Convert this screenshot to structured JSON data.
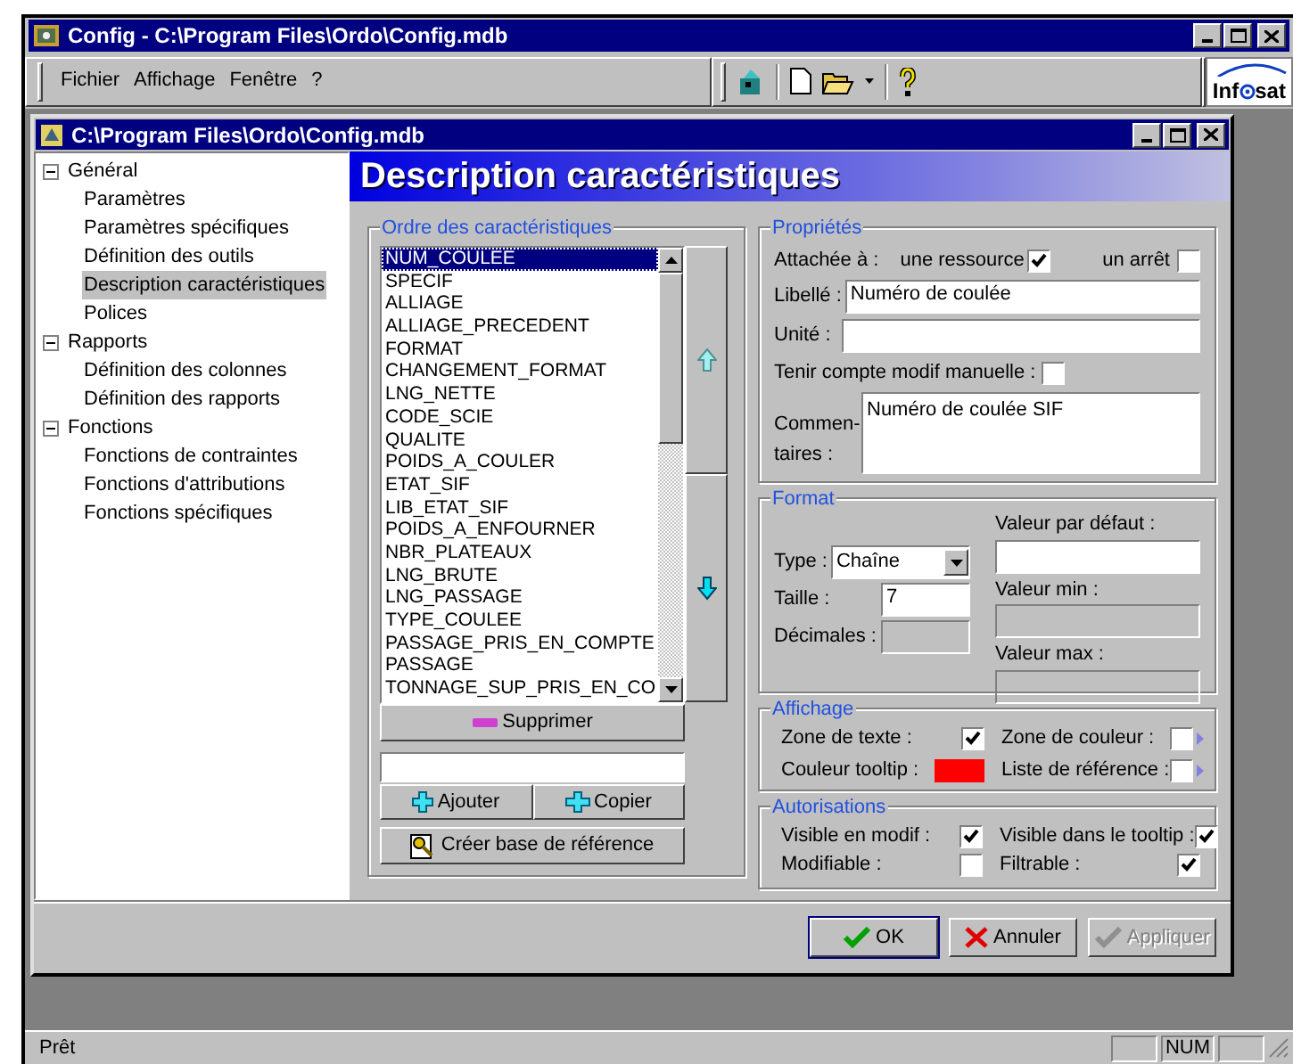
{
  "window": {
    "title": "Config - C:\\Program Files\\Ordo\\Config.mdb"
  },
  "menu": [
    "Fichier",
    "Affichage",
    "Fenêtre",
    "?"
  ],
  "logo": {
    "left": "Inf",
    "right": "sat"
  },
  "child_window": {
    "title": "C:\\Program Files\\Ordo\\Config.mdb"
  },
  "tree": [
    {
      "label": "Général",
      "expanded": true,
      "selected": false,
      "children": [
        {
          "label": "Paramètres",
          "selected": false
        },
        {
          "label": "Paramètres spécifiques",
          "selected": false
        },
        {
          "label": "Définition des outils",
          "selected": false
        },
        {
          "label": "Description caractéristiques",
          "selected": true
        },
        {
          "label": "Polices",
          "selected": false
        }
      ]
    },
    {
      "label": "Rapports",
      "expanded": true,
      "selected": false,
      "children": [
        {
          "label": "Définition des colonnes",
          "selected": false
        },
        {
          "label": "Définition des rapports",
          "selected": false
        }
      ]
    },
    {
      "label": "Fonctions",
      "expanded": true,
      "selected": false,
      "children": [
        {
          "label": "Fonctions de contraintes",
          "selected": false
        },
        {
          "label": "Fonctions d'attributions",
          "selected": false
        },
        {
          "label": "Fonctions spécifiques",
          "selected": false
        }
      ]
    }
  ],
  "header": {
    "title": "Description caractéristiques"
  },
  "order": {
    "title": "Ordre des caractéristiques",
    "items": [
      {
        "label": "NUM_COULEE",
        "selected": true
      },
      {
        "label": "SPECIF",
        "selected": false
      },
      {
        "label": "ALLIAGE",
        "selected": false
      },
      {
        "label": "ALLIAGE_PRECEDENT",
        "selected": false
      },
      {
        "label": "FORMAT",
        "selected": false
      },
      {
        "label": "CHANGEMENT_FORMAT",
        "selected": false
      },
      {
        "label": "LNG_NETTE",
        "selected": false
      },
      {
        "label": "CODE_SCIE",
        "selected": false
      },
      {
        "label": "QUALITE",
        "selected": false
      },
      {
        "label": "POIDS_A_COULER",
        "selected": false
      },
      {
        "label": "ETAT_SIF",
        "selected": false
      },
      {
        "label": "LIB_ETAT_SIF",
        "selected": false
      },
      {
        "label": "POIDS_A_ENFOURNER",
        "selected": false
      },
      {
        "label": "NBR_PLATEAUX",
        "selected": false
      },
      {
        "label": "LNG_BRUTE",
        "selected": false
      },
      {
        "label": "LNG_PASSAGE",
        "selected": false
      },
      {
        "label": "TYPE_COULEE",
        "selected": false
      },
      {
        "label": "PASSAGE_PRIS_EN_COMPTE",
        "selected": false
      },
      {
        "label": "PASSAGE",
        "selected": false
      },
      {
        "label": "TONNAGE_SUP_PRIS_EN_CO",
        "selected": false
      }
    ],
    "delete_button": "Supprimer",
    "add_button": "Ajouter",
    "copy_button": "Copier",
    "create_button": "Créer base de référence"
  },
  "properties": {
    "title": "Propriétés",
    "attached_label": "Attachée à :",
    "resource": {
      "label": "une ressource",
      "checked": true
    },
    "stop": {
      "label": "un arrêt",
      "checked": false
    },
    "libelle": {
      "label": "Libellé :",
      "value": "Numéro de coulée"
    },
    "unit": {
      "label": "Unité :"
    },
    "manual": {
      "label": "Tenir compte modif manuelle :",
      "checked": false
    },
    "comments": {
      "label_1": "Commen-",
      "label_2": "taires :",
      "value": "Numéro de coulée SIF"
    }
  },
  "format": {
    "title": "Format",
    "type_label": "Type :",
    "type_value": "Chaîne",
    "size_label": "Taille :",
    "size_value": "7",
    "decimals_label": "Décimales :",
    "default_label": "Valeur par défaut :",
    "min_label": "Valeur min :",
    "max_label": "Valeur max :"
  },
  "display": {
    "title": "Affichage",
    "text_zone": {
      "label": "Zone de texte :",
      "checked": true
    },
    "color_zone": {
      "label": "Zone de couleur :",
      "checked": false
    },
    "tooltip_color": {
      "label": "Couleur tooltip :",
      "color": "#ff0000"
    },
    "ref_list": {
      "label": "Liste de référence :",
      "checked": false
    }
  },
  "permissions": {
    "title": "Autorisations",
    "items": [
      {
        "label": "Visible en modif :",
        "checked": true
      },
      {
        "label": "Visible dans le tooltip :",
        "checked": true
      },
      {
        "label": "Modifiable :",
        "checked": false
      },
      {
        "label": "Filtrable :",
        "checked": true
      }
    ]
  },
  "buttons": [
    {
      "label": "OK",
      "kind": "ok",
      "disabled": false
    },
    {
      "label": "Annuler",
      "kind": "cancel",
      "disabled": false
    },
    {
      "label": "Appliquer",
      "kind": "apply",
      "disabled": true
    }
  ],
  "status_bar": {
    "text": "Prêt",
    "indicator": "NUM"
  }
}
